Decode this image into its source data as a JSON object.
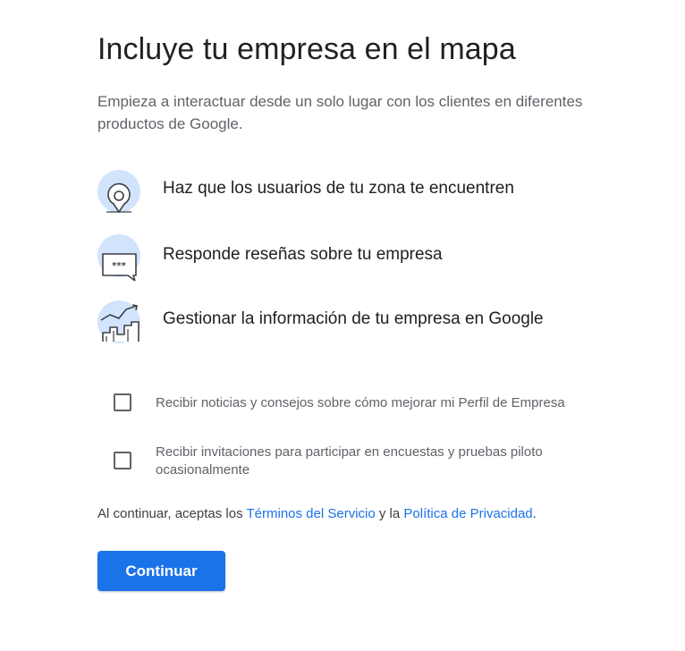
{
  "header": {
    "title": "Incluye tu empresa en el mapa",
    "subtitle": "Empieza a interactuar desde un solo lugar con los clientes en diferentes productos de Google."
  },
  "features": [
    {
      "icon": "map-pin-icon",
      "text": "Haz que los usuarios de tu zona te encuentren"
    },
    {
      "icon": "review-stars-icon",
      "text": "Responde reseñas sobre tu empresa"
    },
    {
      "icon": "growth-chart-icon",
      "text": "Gestionar la información de tu empresa en Google"
    }
  ],
  "options": [
    {
      "label": "Recibir noticias y consejos sobre cómo mejorar mi Perfil de Empresa",
      "checked": false
    },
    {
      "label": "Recibir invitaciones para participar en encuestas y pruebas piloto ocasionalmente",
      "checked": false
    }
  ],
  "terms": {
    "prefix": "Al continuar, aceptas los ",
    "tos_link": "Términos del Servicio",
    "middle": " y la ",
    "privacy_link": "Política de Privacidad",
    "suffix": "."
  },
  "actions": {
    "continue_label": "Continuar"
  },
  "colors": {
    "accent": "#1a73e8",
    "icon_bg": "#d2e3fc",
    "text_primary": "#202124",
    "text_secondary": "#5f6368"
  }
}
